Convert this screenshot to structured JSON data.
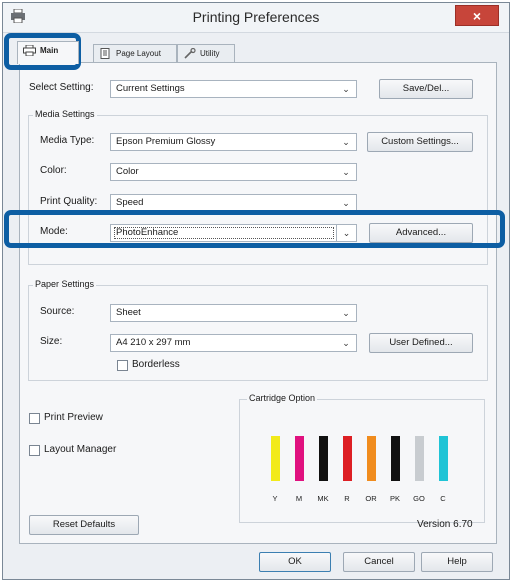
{
  "window": {
    "title": "Printing Preferences",
    "close": "×"
  },
  "tabs": [
    {
      "label": "Main"
    },
    {
      "label": "Page Layout"
    },
    {
      "label": "Utility"
    }
  ],
  "select_setting": {
    "label": "Select Setting:",
    "value": "Current Settings",
    "button": "Save/Del..."
  },
  "media_settings": {
    "title": "Media Settings",
    "media_type": {
      "label": "Media Type:",
      "value": "Epson Premium Glossy",
      "button": "Custom Settings..."
    },
    "color": {
      "label": "Color:",
      "value": "Color"
    },
    "print_quality": {
      "label": "Print Quality:",
      "value": "Speed"
    },
    "mode": {
      "label": "Mode:",
      "value": "PhotoEnhance",
      "button": "Advanced..."
    }
  },
  "paper_settings": {
    "title": "Paper Settings",
    "source": {
      "label": "Source:",
      "value": "Sheet"
    },
    "size": {
      "label": "Size:",
      "value": "A4 210 x 297 mm",
      "button": "User Defined..."
    },
    "borderless": {
      "label": "Borderless",
      "checked": false
    }
  },
  "options": {
    "print_preview": {
      "label": "Print Preview",
      "checked": false
    },
    "layout_manager": {
      "label": "Layout Manager",
      "checked": false
    }
  },
  "cartridge": {
    "title": "Cartridge Option",
    "inks": [
      {
        "code": "Y",
        "color": "#f2ea1a"
      },
      {
        "code": "M",
        "color": "#e0117f"
      },
      {
        "code": "MK",
        "color": "#111111"
      },
      {
        "code": "R",
        "color": "#dd1f24"
      },
      {
        "code": "OR",
        "color": "#f08c1e"
      },
      {
        "code": "PK",
        "color": "#111111"
      },
      {
        "code": "GO",
        "color": "#c8ccd0"
      },
      {
        "code": "C",
        "color": "#1fc4d6"
      }
    ]
  },
  "footer": {
    "reset": "Reset Defaults",
    "version": "Version 6.70",
    "ok": "OK",
    "cancel": "Cancel",
    "help": "Help"
  },
  "colors": {
    "highlight": "#0d5ea3",
    "close_button": "#c7453a"
  }
}
